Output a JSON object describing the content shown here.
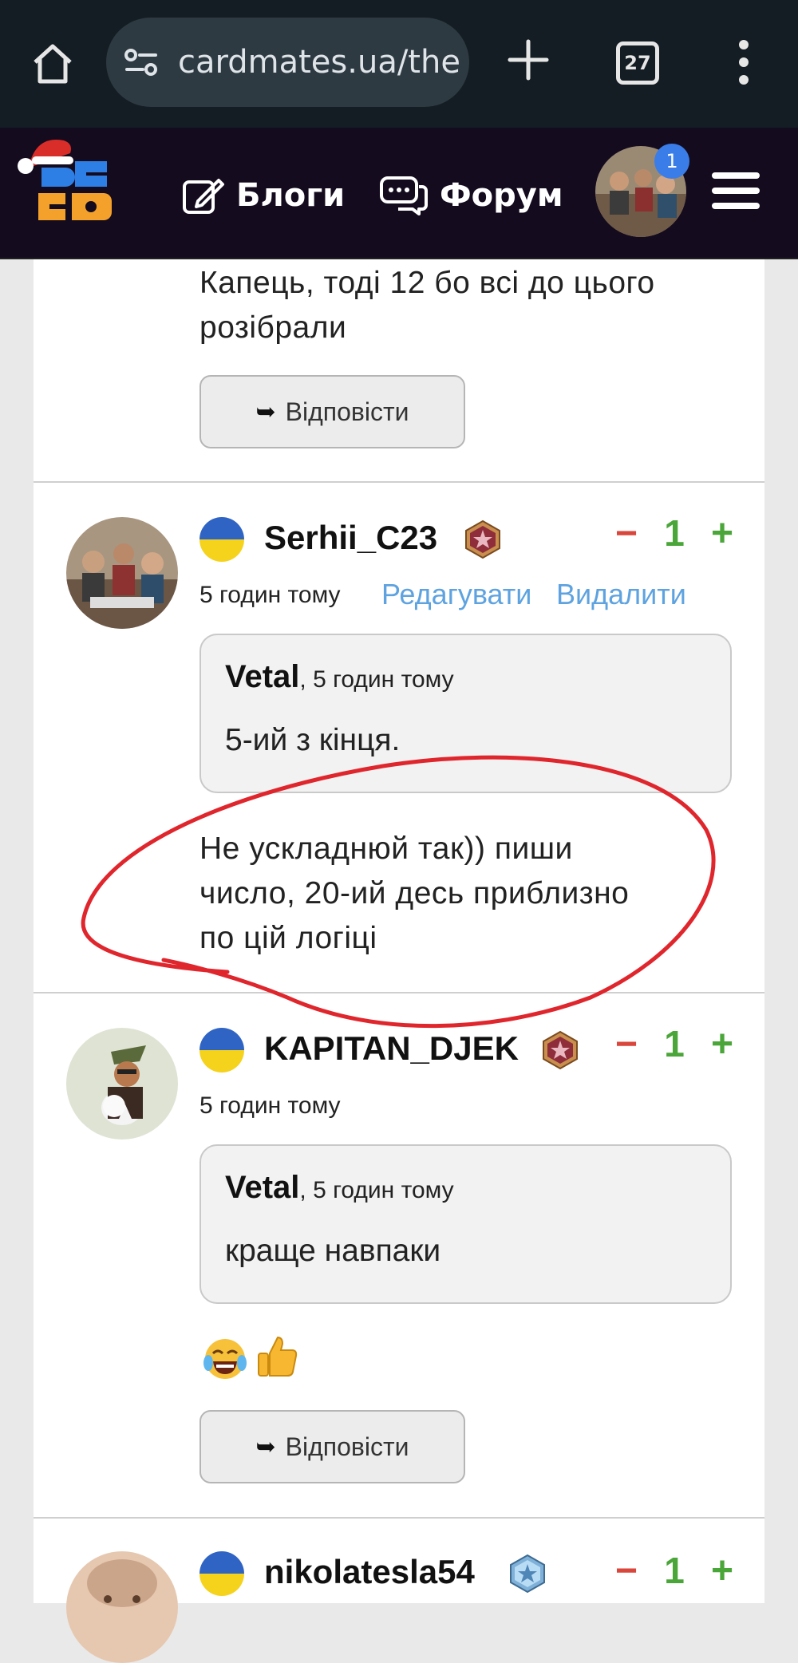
{
  "browser": {
    "url": "cardmates.ua/the",
    "tab_count": "27"
  },
  "site_nav": {
    "blogs_label": "Блоги",
    "forum_label": "Форум",
    "notification_count": "1"
  },
  "comments": [
    {
      "text_lines": [
        "Капець, тоді 12 бо всі до цього",
        "розібрали"
      ],
      "reply_label": "Відповісти"
    },
    {
      "username": "Serhii_C23",
      "score": "1",
      "time": "5 годин тому",
      "edit_label": "Редагувати",
      "delete_label": "Видалити",
      "quote": {
        "author": "Vetal",
        "time": "5 годин тому",
        "text": "5-ий з кінця."
      },
      "text_lines": [
        "Не ускладнюй так)) пиши",
        "число, 20-ий десь приблизно",
        "по цій логіці"
      ]
    },
    {
      "username": "KAPITAN_DJEK",
      "score": "1",
      "time": "5 годин тому",
      "quote": {
        "author": "Vetal",
        "time": "5 годин тому",
        "text": "краще навпаки"
      },
      "emojis": [
        "tears-of-joy-emoji",
        "thumbs-up-emoji"
      ],
      "reply_label": "Відповісти"
    },
    {
      "username": "nikolatesla54",
      "score": "1"
    }
  ],
  "vote_symbols": {
    "down": "−",
    "up": "+"
  },
  "quote_separator": ", ",
  "colors": {
    "browser_bar": "#141d23",
    "site_header": "#140b1e",
    "link": "#5ea3e0",
    "vote_down": "#d9463b",
    "vote_up": "#4ba63a",
    "annotation": "#e0262d"
  }
}
